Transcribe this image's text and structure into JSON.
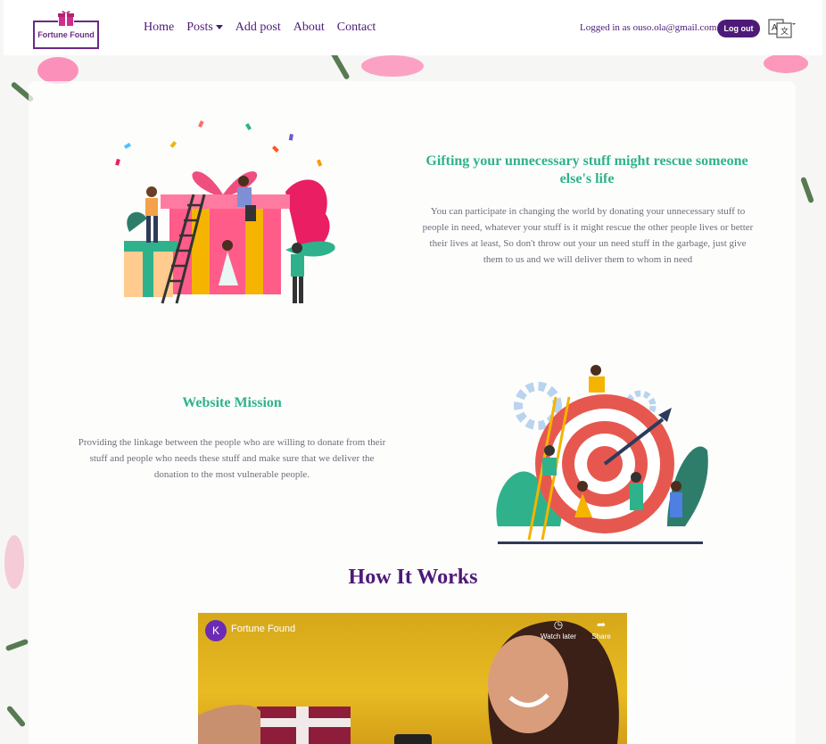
{
  "brand": {
    "name": "Fortune Found"
  },
  "nav": {
    "items": [
      {
        "label": "Home"
      },
      {
        "label": "Posts",
        "has_dropdown": true
      },
      {
        "label": "Add post"
      },
      {
        "label": "About"
      },
      {
        "label": "Contact"
      }
    ],
    "logged_in_text": "Logged in as ouso.ola@gmail.com",
    "logout_label": "Log out",
    "language_icon": "translate-icon"
  },
  "gifting": {
    "title": "Gifting your unnecessary stuff might rescue someone else's life",
    "text": "You can participate in changing the world by donating your unnecessary stuff to people in need, whatever your stuff is it might rescue the other people lives or better their lives at least, So don't throw out your un need stuff in the garbage, just give them to us and we will deliver them to whom in need"
  },
  "mission": {
    "title": "Website Mission",
    "text": "Providing the linkage between the people who are willing to donate from their stuff and people who needs these stuff and make sure that we deliver the donation to the most vulnerable people."
  },
  "how_it_works": {
    "title": "How It Works",
    "video": {
      "channel_initial": "K",
      "title": "Fortune Found",
      "watch_later_label": "Watch later",
      "share_label": "Share"
    }
  },
  "colors": {
    "primary": "#4d1a78",
    "accent": "#2fb28c",
    "text_muted": "#6c6c7c"
  }
}
